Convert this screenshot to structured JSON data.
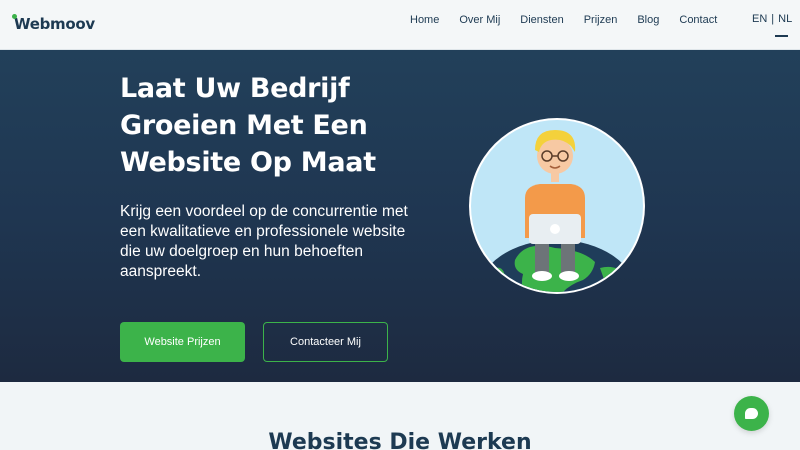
{
  "brand": {
    "logo_text": "Webmoov",
    "accent": "#3cb34a",
    "navy": "#1d3a52"
  },
  "nav": {
    "items": [
      "Home",
      "Over Mij",
      "Diensten",
      "Prijzen",
      "Blog",
      "Contact"
    ],
    "lang_en": "EN",
    "lang_sep": "|",
    "lang_nl": "NL",
    "active_lang": "NL"
  },
  "hero": {
    "headline": "Laat Uw Bedrijf Groeien Met Een Website Op Maat",
    "subtext": "Krijg een voordeel op de concurrentie met een kwalitatieve en professionele website die uw doelgroep en hun behoeften aanspreekt.",
    "primary_button": "Website Prijzen",
    "secondary_button": "Contacteer Mij",
    "illustration_icon": "person-with-laptop-on-globe-illustration"
  },
  "section": {
    "title": "Websites Die Werken"
  },
  "chat": {
    "icon": "chat-bubble-icon"
  }
}
